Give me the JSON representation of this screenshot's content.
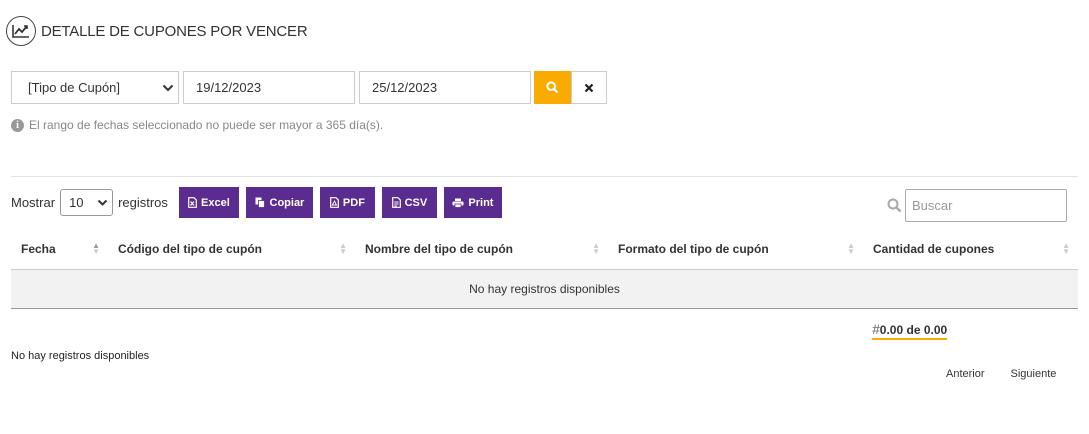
{
  "header": {
    "title": "DETALLE DE CUPONES POR VENCER",
    "icon": "trend-chart-icon"
  },
  "filters": {
    "coupon_type": "[Tipo de Cupón]",
    "date_from": "19/12/2023",
    "date_to": "25/12/2023",
    "note": "El rango de fechas seleccionado no puede ser mayor a 365 día(s)."
  },
  "toolbar": {
    "show_label": "Mostrar",
    "page_length": "10",
    "records_label": "registros",
    "buttons": {
      "excel": "Excel",
      "copy": "Copiar",
      "pdf": "PDF",
      "csv": "CSV",
      "print": "Print"
    },
    "search_placeholder": "Buscar"
  },
  "table": {
    "columns": [
      "Fecha",
      "Código del tipo de cupón",
      "Nombre del tipo de cupón",
      "Formato del tipo de cupón",
      "Cantidad de cupones"
    ],
    "empty_message": "No hay registros disponibles"
  },
  "summary": {
    "total": "0.00 de 0.00",
    "hash": "#"
  },
  "footer": {
    "info": "No hay registros disponibles",
    "previous": "Anterior",
    "next": "Siguiente"
  },
  "colors": {
    "accent": "#f9ab00",
    "button": "#5b2c8f"
  }
}
